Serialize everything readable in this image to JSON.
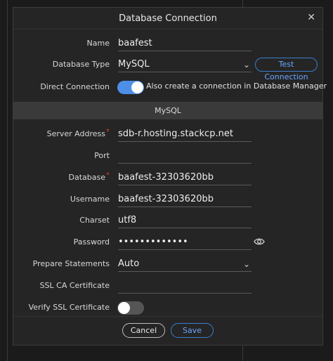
{
  "dialog": {
    "title": "Database Connection"
  },
  "fields": {
    "name": {
      "label": "Name",
      "value": "baafest"
    },
    "database_type": {
      "label": "Database Type",
      "value": "MySQL"
    },
    "test_connection": {
      "label": "Test Connection"
    },
    "direct_connection": {
      "label": "Direct Connection",
      "enabled": true,
      "description": "Also create a connection in Database Manager"
    },
    "section_title": "MySQL",
    "server_address": {
      "label": "Server Address",
      "value": "sdb-r.hosting.stackcp.net",
      "required": "*"
    },
    "port": {
      "label": "Port",
      "value": ""
    },
    "database": {
      "label": "Database",
      "value": "baafest-32303620bb",
      "required": "*"
    },
    "username": {
      "label": "Username",
      "value": "baafest-32303620bb"
    },
    "charset": {
      "label": "Charset",
      "value": "utf8"
    },
    "password": {
      "label": "Password",
      "value": "•••••••••••••"
    },
    "prepare_statements": {
      "label": "Prepare Statements",
      "value": "Auto"
    },
    "ssl_ca": {
      "label": "SSL CA Certificate",
      "value": ""
    },
    "verify_ssl": {
      "label": "Verify SSL Certificate",
      "enabled": false
    }
  },
  "footer": {
    "cancel_label": "Cancel",
    "save_label": "Save"
  },
  "icons": {
    "close": "close-icon",
    "chevron": "chevron-down-icon",
    "eye": "eye-icon"
  },
  "colors": {
    "accent": "#3d7dd0",
    "toggle_on": "#4d8fe6",
    "toggle_off": "#555555",
    "required": "#e03b3b"
  }
}
